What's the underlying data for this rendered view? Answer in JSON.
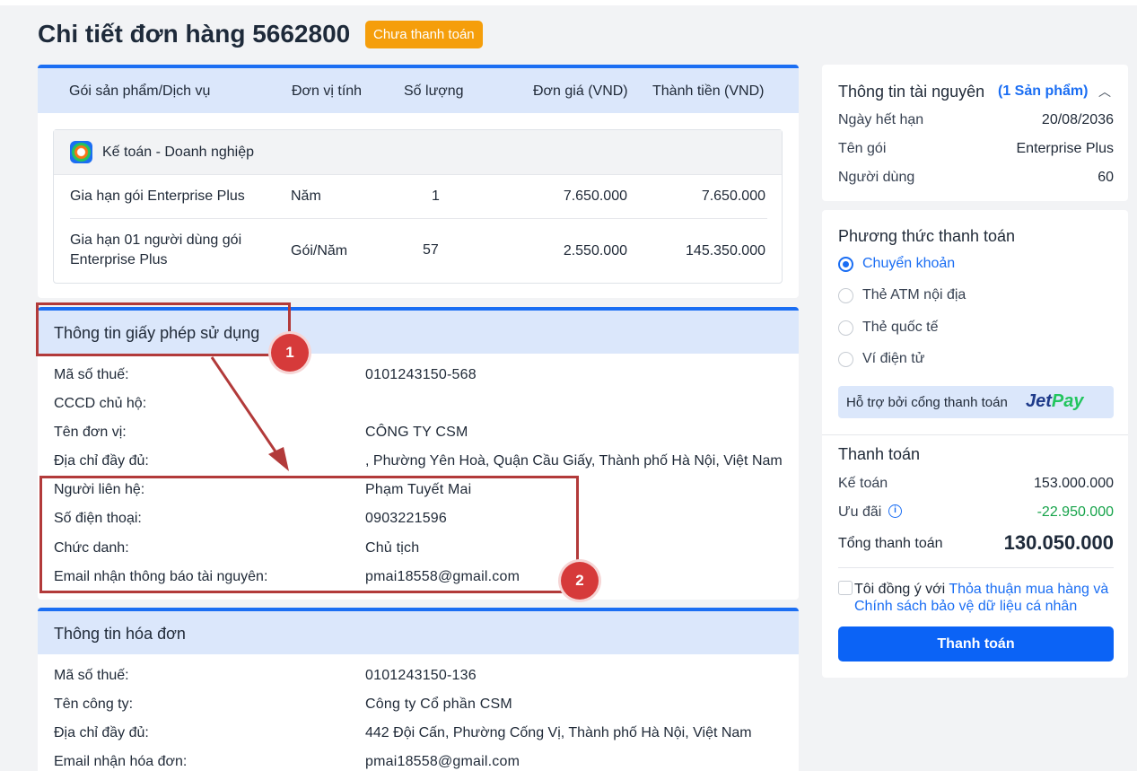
{
  "title": "Chi tiết đơn hàng 5662800",
  "status": "Chưa thanh toán",
  "products_table": {
    "columns": [
      "Gói sản phẩm/Dịch vụ",
      "Đơn vị tính",
      "Số lượng",
      "Đơn giá (VND)",
      "Thành tiền (VND)"
    ],
    "group_name": "Kế toán - Doanh nghiệp",
    "rows": [
      {
        "name": "Gia hạn gói Enterprise Plus",
        "unit": "Năm",
        "qty": "1",
        "price": "7.650.000",
        "total": "7.650.000"
      },
      {
        "name_line1": "Gia hạn 01 người dùng gói",
        "name_line2": "Enterprise Plus",
        "unit": "Gói/Năm",
        "qty": "57",
        "price": "2.550.000",
        "total": "145.350.000"
      }
    ]
  },
  "license": {
    "title": "Thông tin giấy phép sử dụng",
    "rows": [
      {
        "label": "Mã số thuế:",
        "value": "0101243150-568"
      },
      {
        "label": "CCCD chủ hộ:",
        "value": ""
      },
      {
        "label": "Tên đơn vị:",
        "value": "CÔNG TY CSM"
      },
      {
        "label": "Địa chỉ đầy đủ:",
        "value": ", Phường Yên Hoà, Quận Cầu Giấy, Thành phố Hà Nội, Việt Nam"
      },
      {
        "label": "Người liên hệ:",
        "value": "Phạm Tuyết Mai"
      },
      {
        "label": "Số điện thoại:",
        "value": "0903221596"
      },
      {
        "label": "Chức danh:",
        "value": "Chủ tịch"
      },
      {
        "label": "Email nhận thông báo tài nguyên:",
        "value": "pmai18558@gmail.com"
      }
    ]
  },
  "invoice": {
    "title": "Thông tin hóa đơn",
    "rows": [
      {
        "label": "Mã số thuế:",
        "value": "0101243150-136"
      },
      {
        "label": "Tên công ty:",
        "value": "Công ty Cổ phần CSM"
      },
      {
        "label": "Địa chỉ đầy đủ:",
        "value": "442 Đội Cấn, Phường Cống Vị, Thành phố Hà Nội, Việt Nam"
      },
      {
        "label": "Email nhận hóa đơn:",
        "value": "pmai18558@gmail.com"
      }
    ]
  },
  "annotations": [
    "1",
    "2"
  ],
  "resource": {
    "title": "Thông tin tài nguyên",
    "count": "(1 Sản phẩm)",
    "rows": [
      {
        "label": "Ngày hết hạn",
        "value": "20/08/2036"
      },
      {
        "label": "Tên gói",
        "value": "Enterprise Plus"
      },
      {
        "label": "Người dùng",
        "value": "60"
      }
    ]
  },
  "payment_method": {
    "title": "Phương thức thanh toán",
    "options": [
      "Chuyển khoản",
      "Thẻ ATM nội địa",
      "Thẻ quốc tế",
      "Ví điện tử"
    ],
    "selected": "Chuyển khoản",
    "support_text": "Hỗ trợ bởi cổng thanh toán",
    "logo_jet": "Jet",
    "logo_pay": "Pay"
  },
  "payment": {
    "title": "Thanh toán",
    "rows": [
      {
        "label": "Kế toán",
        "value": "153.000.000"
      },
      {
        "label": "Ưu đãi",
        "value": "-22.950.000"
      }
    ],
    "total_label": "Tổng thanh toán",
    "total_value": "130.050.000",
    "agree_prefix": "Tôi đồng ý với",
    "agree_link1": "Thỏa thuận mua hàng",
    "agree_and": "và",
    "agree_link2": "Chính sách bảo vệ dữ liệu cá nhân",
    "button": "Thanh toán"
  },
  "colors": {
    "accent": "#1b6ef3",
    "badge": "#f59e0b",
    "annotation": "#b23a3a",
    "discount": "#16a34a"
  }
}
